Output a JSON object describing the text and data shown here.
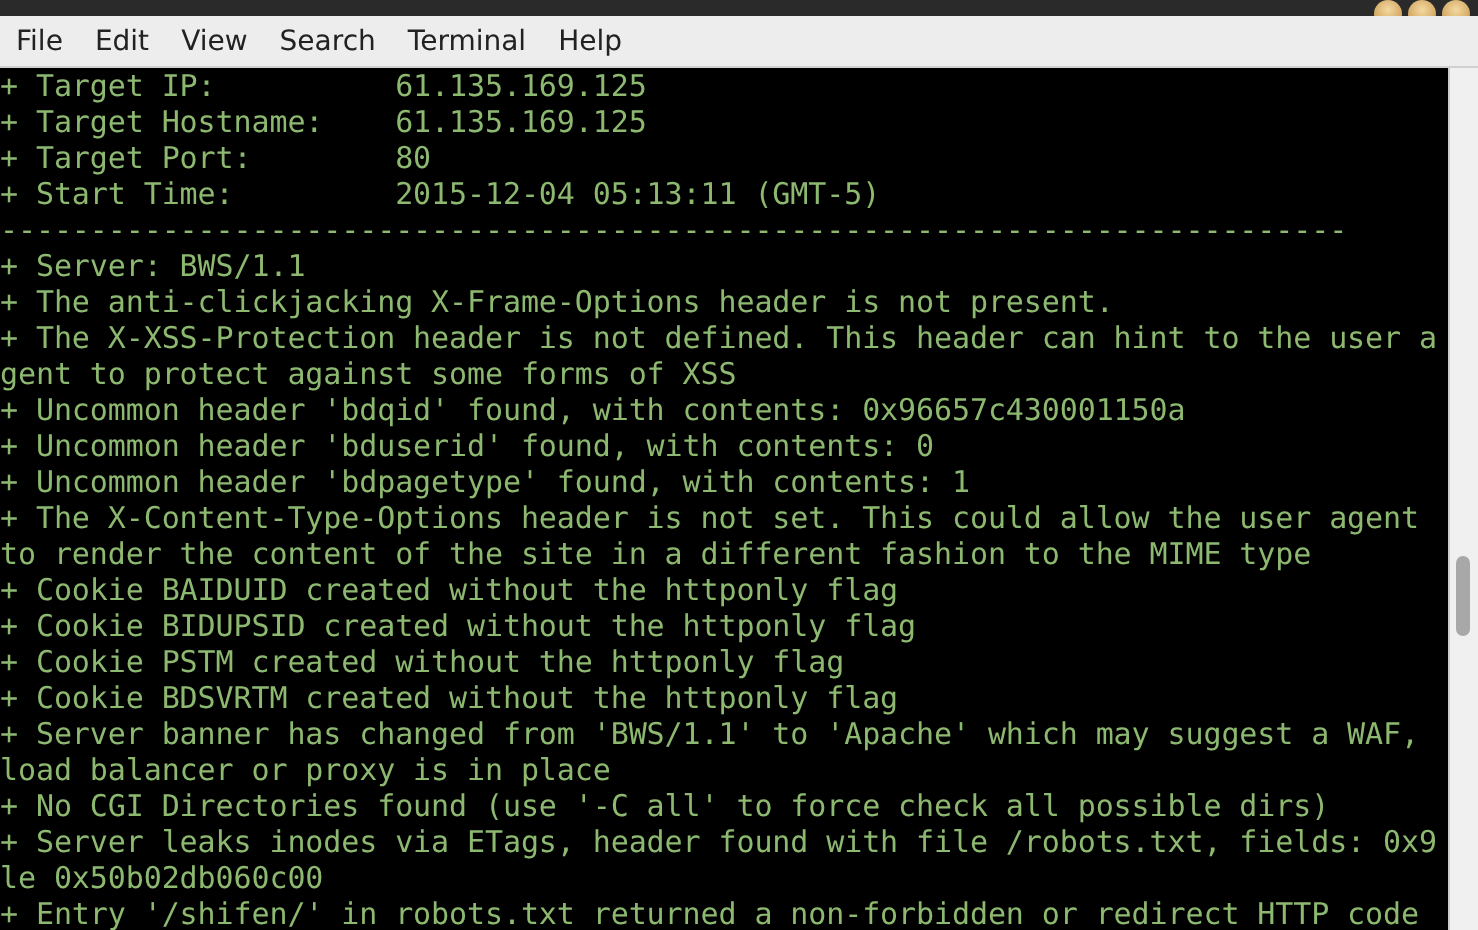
{
  "menu": [
    "File",
    "Edit",
    "View",
    "Search",
    "Terminal",
    "Help"
  ],
  "terminal": {
    "lines": [
      "+ Target IP:          61.135.169.125",
      "+ Target Hostname:    61.135.169.125",
      "+ Target Port:        80",
      "+ Start Time:         2015-12-04 05:13:11 (GMT-5)",
      "---------------------------------------------------------------------------",
      "+ Server: BWS/1.1",
      "+ The anti-clickjacking X-Frame-Options header is not present.",
      "+ The X-XSS-Protection header is not defined. This header can hint to the user a",
      "gent to protect against some forms of XSS",
      "+ Uncommon header 'bdqid' found, with contents: 0x96657c430001150a",
      "+ Uncommon header 'bduserid' found, with contents: 0",
      "+ Uncommon header 'bdpagetype' found, with contents: 1",
      "+ The X-Content-Type-Options header is not set. This could allow the user agent",
      "to render the content of the site in a different fashion to the MIME type",
      "+ Cookie BAIDUID created without the httponly flag",
      "+ Cookie BIDUPSID created without the httponly flag",
      "+ Cookie PSTM created without the httponly flag",
      "+ Cookie BDSVRTM created without the httponly flag",
      "+ Server banner has changed from 'BWS/1.1' to 'Apache' which may suggest a WAF,",
      "load balancer or proxy is in place",
      "+ No CGI Directories found (use '-C all' to force check all possible dirs)",
      "+ Server leaks inodes via ETags, header found with file /robots.txt, fields: 0x9",
      "le 0x50b02db060c00",
      "+ Entry '/shifen/' in robots.txt returned a non-forbidden or redirect HTTP code"
    ]
  }
}
